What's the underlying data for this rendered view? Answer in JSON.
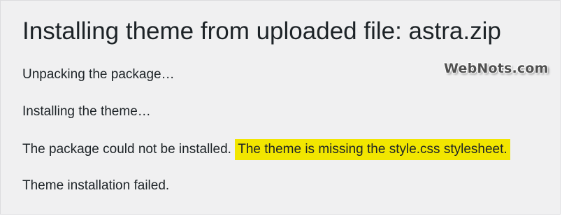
{
  "page": {
    "title": "Installing theme from uploaded file: astra.zip"
  },
  "watermark": {
    "text": "WebNots.com"
  },
  "log": {
    "unpacking": "Unpacking the package…",
    "installing": "Installing the theme…",
    "error_prefix": "The package could not be installed.",
    "error_detail": "The theme is missing the style.css stylesheet.",
    "failed": "Theme installation failed."
  },
  "colors": {
    "background": "#f0f0f1",
    "text": "#1d2327",
    "highlight": "#f2e600"
  }
}
